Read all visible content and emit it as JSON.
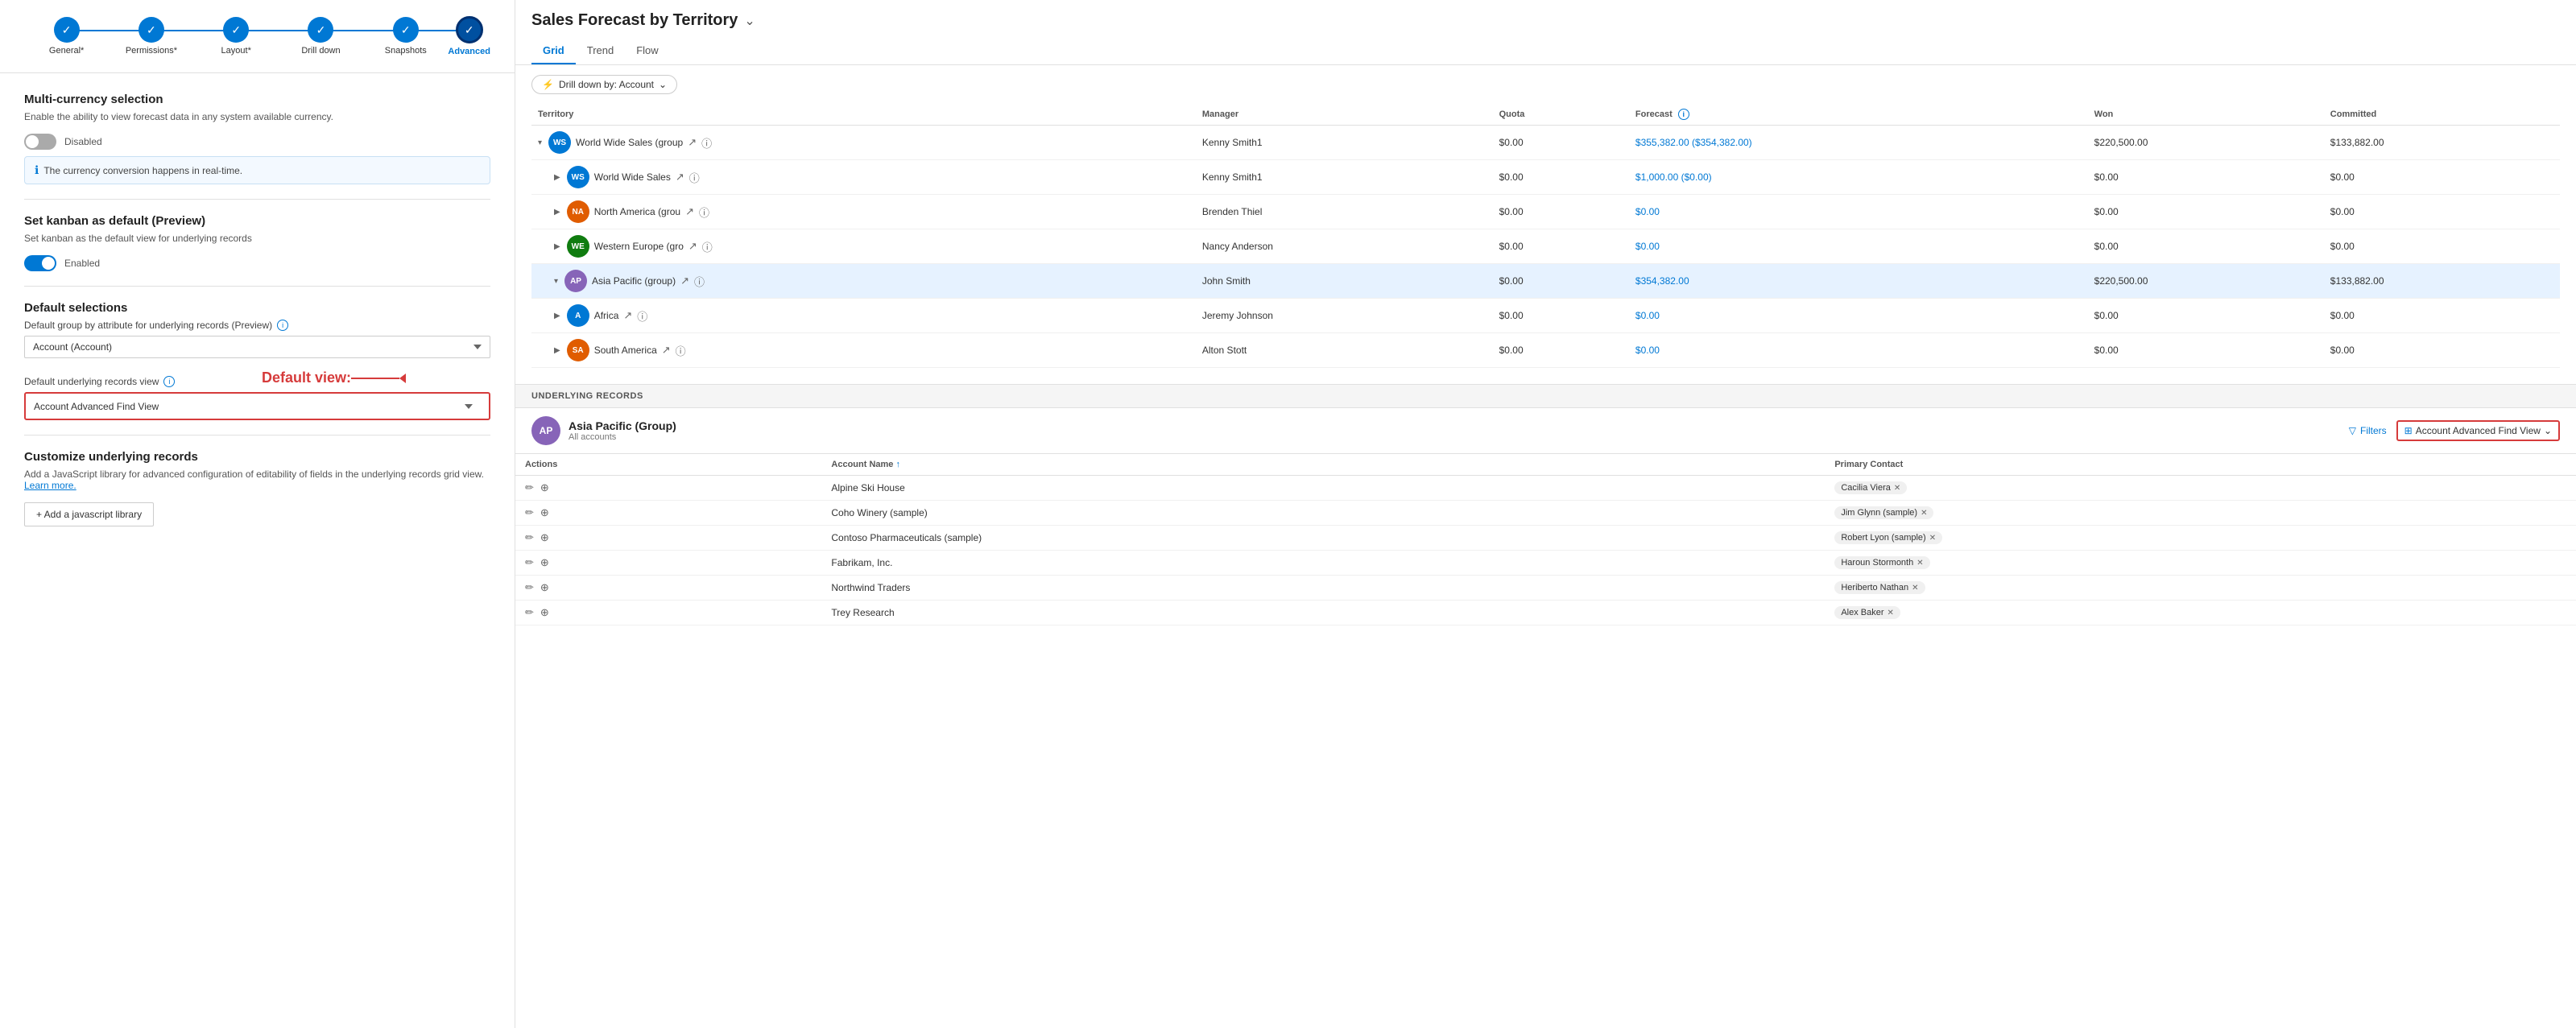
{
  "stepper": {
    "steps": [
      {
        "id": "general",
        "label": "General*",
        "done": true
      },
      {
        "id": "permissions",
        "label": "Permissions*",
        "done": true
      },
      {
        "id": "layout",
        "label": "Layout*",
        "done": true
      },
      {
        "id": "drilldown",
        "label": "Drill down",
        "done": true
      },
      {
        "id": "snapshots",
        "label": "Snapshots",
        "done": true
      },
      {
        "id": "advanced",
        "label": "Advanced",
        "done": true,
        "active": true
      }
    ]
  },
  "left": {
    "multicurrency": {
      "title": "Multi-currency selection",
      "desc": "Enable the ability to view forecast data in any system available currency.",
      "toggle": "Disabled",
      "toggle_state": "off",
      "info": "The currency conversion happens in real-time."
    },
    "kanban": {
      "title": "Set kanban as default (Preview)",
      "desc": "Set kanban as the default view for underlying records",
      "toggle": "Enabled",
      "toggle_state": "on"
    },
    "default_selections": {
      "title": "Default selections",
      "group_label": "Default group by attribute for underlying records (Preview)",
      "group_value": "Account (Account)",
      "view_label": "Default underlying records view",
      "view_value": "Account Advanced Find View",
      "annotation": "Default view:"
    },
    "customize": {
      "title": "Customize underlying records",
      "desc": "Add a JavaScript library for advanced configuration of editability of fields in the underlying records grid view.",
      "learn_more": "Learn more.",
      "btn_label": "+ Add a javascript library"
    }
  },
  "forecast": {
    "title": "Sales Forecast by Territory",
    "tabs": [
      "Grid",
      "Trend",
      "Flow"
    ],
    "active_tab": "Grid",
    "drill_down_label": "Drill down by: Account",
    "columns": [
      "Territory",
      "Manager",
      "Quota",
      "Forecast",
      "Won",
      "Committed"
    ],
    "rows": [
      {
        "indent": 0,
        "expanded": true,
        "avatar": "WS",
        "avatar_bg": "ws-bg",
        "name": "World Wide Sales (group",
        "manager": "Kenny Smith1",
        "quota": "$0.00",
        "forecast": "$355,382.00 ($354,382.00)",
        "won": "$220,500.00",
        "committed": "$133,882.00",
        "highlighted": false
      },
      {
        "indent": 1,
        "expanded": false,
        "avatar": "WS",
        "avatar_bg": "ws-bg",
        "name": "World Wide Sales",
        "manager": "Kenny Smith1",
        "quota": "$0.00",
        "forecast": "$1,000.00 ($0.00)",
        "won": "$0.00",
        "committed": "$0.00",
        "highlighted": false
      },
      {
        "indent": 1,
        "expanded": false,
        "avatar": "NA",
        "avatar_bg": "na-bg",
        "name": "North America (grou",
        "manager": "Brenden Thiel",
        "quota": "$0.00",
        "forecast": "$0.00",
        "won": "$0.00",
        "committed": "$0.00",
        "highlighted": false
      },
      {
        "indent": 1,
        "expanded": false,
        "avatar": "WE",
        "avatar_bg": "we-bg",
        "name": "Western Europe (gro",
        "manager": "Nancy Anderson",
        "quota": "$0.00",
        "forecast": "$0.00",
        "won": "$0.00",
        "committed": "$0.00",
        "highlighted": false
      },
      {
        "indent": 1,
        "expanded": true,
        "avatar": "AP",
        "avatar_bg": "ap-bg",
        "name": "Asia Pacific (group)",
        "manager": "John Smith",
        "quota": "$0.00",
        "forecast": "$354,382.00",
        "won": "$220,500.00",
        "committed": "$133,882.00",
        "highlighted": true
      },
      {
        "indent": 1,
        "expanded": false,
        "avatar": "A",
        "avatar_bg": "af-bg",
        "name": "Africa",
        "manager": "Jeremy Johnson",
        "quota": "$0.00",
        "forecast": "$0.00",
        "won": "$0.00",
        "committed": "$0.00",
        "highlighted": false
      },
      {
        "indent": 1,
        "expanded": false,
        "avatar": "SA",
        "avatar_bg": "sa-bg",
        "name": "South America",
        "manager": "Alton Stott",
        "quota": "$0.00",
        "forecast": "$0.00",
        "won": "$0.00",
        "committed": "$0.00",
        "highlighted": false
      }
    ],
    "underlying": {
      "header": "UNDERLYING RECORDS",
      "group_name": "Asia Pacific (Group)",
      "group_sub": "All accounts",
      "filters_label": "Filters",
      "view_label": "Account Advanced Find View",
      "columns": [
        "Actions",
        "Account Name",
        "Primary Contact"
      ],
      "rows": [
        {
          "name": "Alpine Ski House",
          "contact": "Cacilia Viera"
        },
        {
          "name": "Coho Winery (sample)",
          "contact": "Jim Glynn (sample)"
        },
        {
          "name": "Contoso Pharmaceuticals (sample)",
          "contact": "Robert Lyon (sample)"
        },
        {
          "name": "Fabrikam, Inc.",
          "contact": "Haroun Stormonth"
        },
        {
          "name": "Northwind Traders",
          "contact": "Heriberto Nathan"
        },
        {
          "name": "Trey Research",
          "contact": "Alex Baker"
        }
      ]
    }
  }
}
